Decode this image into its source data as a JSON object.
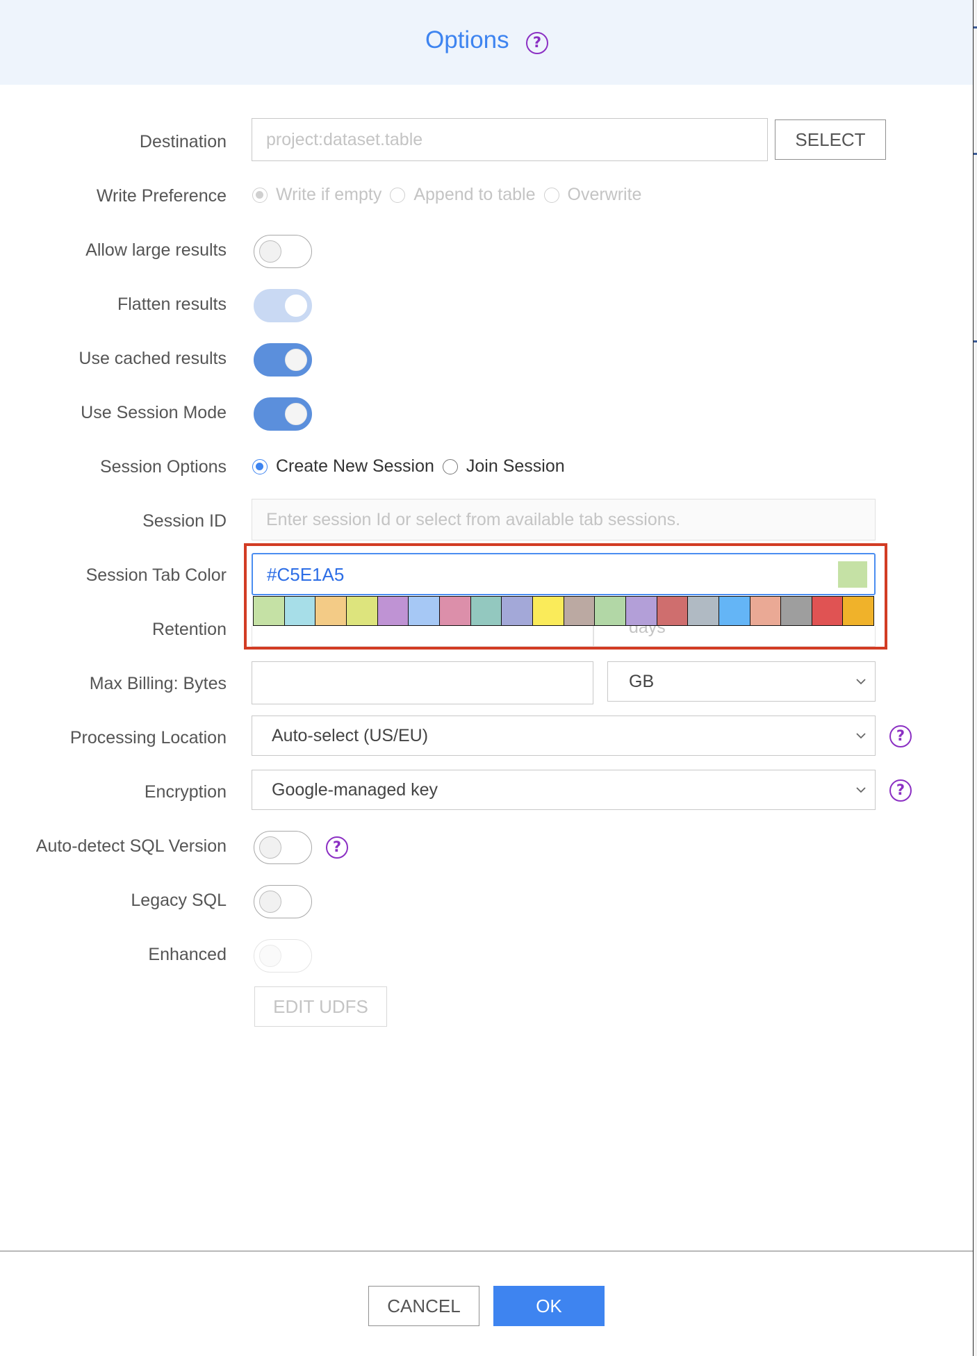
{
  "header": {
    "title": "Options",
    "help_icon": "question-circle-icon"
  },
  "destination": {
    "label": "Destination",
    "placeholder": "project:dataset.table",
    "value": "",
    "select_button": "SELECT"
  },
  "write_preference": {
    "label": "Write Preference",
    "options": [
      {
        "label": "Write if empty",
        "checked": true
      },
      {
        "label": "Append to table",
        "checked": false
      },
      {
        "label": "Overwrite",
        "checked": false
      }
    ]
  },
  "toggles": {
    "allow_large_results": {
      "label": "Allow large results",
      "state": "off"
    },
    "flatten_results": {
      "label": "Flatten results",
      "state": "on-disabled"
    },
    "use_cached_results": {
      "label": "Use cached results",
      "state": "on"
    },
    "use_session_mode": {
      "label": "Use Session Mode",
      "state": "on"
    }
  },
  "session_options": {
    "label": "Session Options",
    "options": [
      {
        "label": "Create New Session",
        "checked": true
      },
      {
        "label": "Join Session",
        "checked": false
      }
    ]
  },
  "session_id": {
    "label": "Session ID",
    "placeholder": "Enter session Id or select from available tab sessions."
  },
  "session_tab_color": {
    "label": "Session Tab Color",
    "value": "#C5E1A5",
    "preview_color": "#c5e1a5",
    "palette": [
      "#c5e1a5",
      "#a7dee8",
      "#f3cb86",
      "#dde47d",
      "#bf93d4",
      "#a6c8f5",
      "#dc8faa",
      "#93c8bf",
      "#a3a8d8",
      "#faeb5a",
      "#bba9a2",
      "#b2d7a6",
      "#b39fd8",
      "#cf6e6e",
      "#b0bac3",
      "#64b5f6",
      "#eaa995",
      "#9e9e9e",
      "#e05353",
      "#f0b22a"
    ]
  },
  "retention": {
    "label": "Retention",
    "unit": "days"
  },
  "max_billing": {
    "label": "Max Billing: Bytes",
    "value": "",
    "unit": "GB"
  },
  "processing_location": {
    "label": "Processing Location",
    "value": "Auto-select (US/EU)"
  },
  "encryption": {
    "label": "Encryption",
    "value": "Google-managed key"
  },
  "auto_detect_sql": {
    "label": "Auto-detect SQL Version",
    "state": "off"
  },
  "legacy_sql": {
    "label": "Legacy SQL",
    "state": "off"
  },
  "enhanced": {
    "label": "Enhanced",
    "state": "off-disabled"
  },
  "edit_udfs": {
    "label": "EDIT UDFS"
  },
  "footer": {
    "cancel": "CANCEL",
    "ok": "OK"
  }
}
